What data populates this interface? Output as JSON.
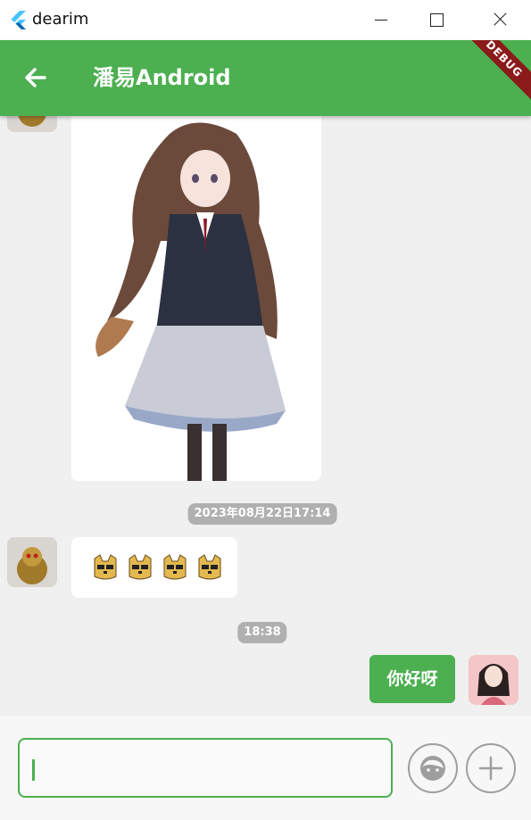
{
  "window": {
    "title": "dearim"
  },
  "appbar": {
    "title": "潘易Android",
    "debug_label": "DEBUG"
  },
  "messages": {
    "timestamp_1": "2023年08月22日17:14",
    "timestamp_2": "18:38",
    "self_text": "你好呀"
  },
  "colors": {
    "primary": "#4caf50",
    "pill": "#b0b0b0",
    "background": "#f0f0f0"
  },
  "icons": [
    "flutter-logo-icon",
    "minimize-icon",
    "maximize-icon",
    "close-icon",
    "back-arrow-icon",
    "emoji-face-icon",
    "plus-icon"
  ]
}
